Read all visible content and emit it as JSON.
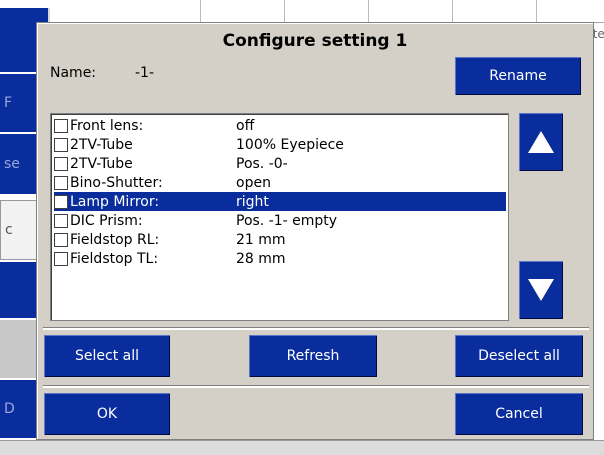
{
  "background": {
    "side_items": [
      "F",
      "se",
      "c",
      "",
      "",
      "D"
    ],
    "right_text": "tte"
  },
  "dialog": {
    "title": "Configure setting 1",
    "name_label": "Name:",
    "name_value": "-1-",
    "rename_label": "Rename",
    "list": {
      "items": [
        {
          "label": "Front lens:",
          "value": "off",
          "checked": false,
          "selected": false
        },
        {
          "label": "2TV-Tube",
          "value": "100% Eyepiece",
          "checked": false,
          "selected": false
        },
        {
          "label": "2TV-Tube",
          "value": "Pos. -0-",
          "checked": false,
          "selected": false
        },
        {
          "label": "Bino-Shutter:",
          "value": "open",
          "checked": false,
          "selected": false
        },
        {
          "label": "Lamp Mirror:",
          "value": "right",
          "checked": false,
          "selected": true
        },
        {
          "label": "DIC Prism:",
          "value": "Pos. -1- empty",
          "checked": false,
          "selected": false
        },
        {
          "label": "Fieldstop RL:",
          "value": "21 mm",
          "checked": false,
          "selected": false
        },
        {
          "label": "Fieldstop TL:",
          "value": "28 mm",
          "checked": false,
          "selected": false
        }
      ]
    },
    "scroll_up_icon": "up-arrow-icon",
    "scroll_down_icon": "down-arrow-icon",
    "select_all_label": "Select all",
    "refresh_label": "Refresh",
    "deselect_all_label": "Deselect all",
    "ok_label": "OK",
    "cancel_label": "Cancel"
  },
  "colors": {
    "button_blue": "#0a2d9e",
    "dialog_gray": "#d4d0c8",
    "selection_blue": "#0a2d9e"
  }
}
